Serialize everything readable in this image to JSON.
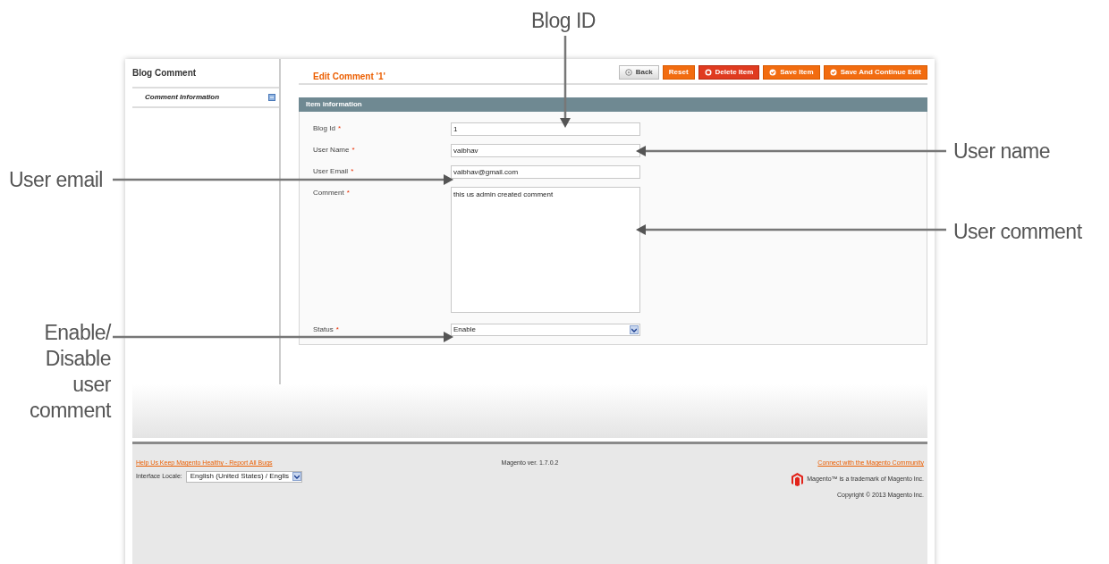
{
  "sidebar": {
    "title": "Blog Comment",
    "items": [
      {
        "label": "Comment Information",
        "selected": true
      }
    ]
  },
  "header": {
    "title": "Edit Comment '1'"
  },
  "buttons": [
    {
      "label": "Back",
      "kind": "back"
    },
    {
      "label": "Reset",
      "kind": "reset"
    },
    {
      "label": "Delete Item",
      "kind": "delete"
    },
    {
      "label": "Save Item",
      "kind": "save"
    },
    {
      "label": "Save And Continue Edit",
      "kind": "save"
    }
  ],
  "section": {
    "title": "Item information"
  },
  "fields": [
    {
      "label": "Blog Id",
      "required_mark": "*",
      "kind": "text",
      "value": "1"
    },
    {
      "label": "User Name",
      "required_mark": "*",
      "kind": "text",
      "value": "vaibhav"
    },
    {
      "label": "User Email",
      "required_mark": "*",
      "kind": "text",
      "value": "vaibhav@gmail.com"
    },
    {
      "label": "Comment",
      "required_mark": "*",
      "kind": "textarea",
      "value": "this us admin created comment"
    },
    {
      "label": "Status",
      "required_mark": "*",
      "kind": "select",
      "value": "Enable"
    }
  ],
  "footer": {
    "report_link": "Help Us Keep Magento Healthy - Report All Bugs",
    "locale_label": "Interface Locale:",
    "locale_value": "English (United States) / Englis",
    "version": "Magento ver. 1.7.0.2",
    "community_link": "Connect with the Magento Community",
    "trademark": "Magento™ is a trademark of Magento Inc.",
    "copyright": "Copyright © 2013 Magento Inc."
  },
  "annotations": [
    {
      "text": "Blog ID"
    },
    {
      "text": "User name"
    },
    {
      "text": "User email"
    },
    {
      "text": "User comment"
    },
    {
      "text": "Enable/ Disable user comment"
    }
  ]
}
